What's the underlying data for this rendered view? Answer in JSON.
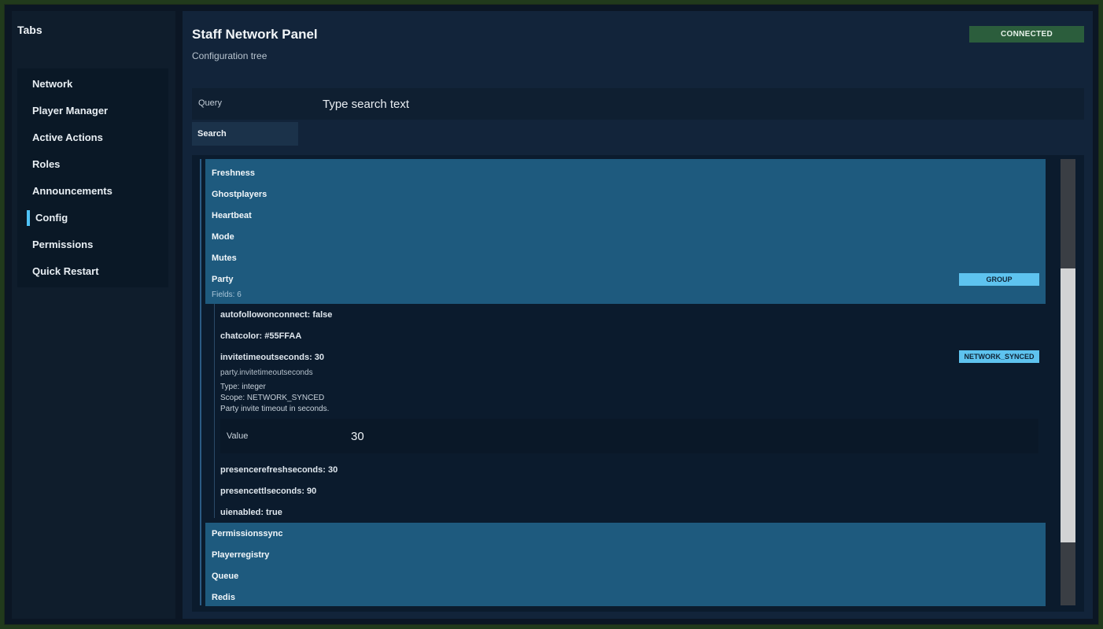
{
  "sidebar": {
    "title": "Tabs",
    "items": [
      {
        "label": "Network"
      },
      {
        "label": "Player Manager"
      },
      {
        "label": "Active Actions"
      },
      {
        "label": "Roles"
      },
      {
        "label": "Announcements"
      },
      {
        "label": "Config",
        "active": true
      },
      {
        "label": "Permissions"
      },
      {
        "label": "Quick Restart"
      }
    ]
  },
  "header": {
    "title": "Staff Network Panel",
    "subtitle": "Configuration tree",
    "status": "CONNECTED"
  },
  "search": {
    "label": "Query",
    "placeholder": "Type search text",
    "button_label": "Search"
  },
  "tree": {
    "groups_before": [
      "Freshness",
      "Ghostplayers",
      "Heartbeat",
      "Mode",
      "Mutes"
    ],
    "expanded_group": {
      "name": "Party",
      "badge": "GROUP",
      "fields_count": "Fields: 6",
      "fields": [
        {
          "label": "autofollowonconnect: false"
        },
        {
          "label": "chatcolor: #55FFAA"
        },
        {
          "label": "invitetimeoutseconds: 30",
          "badge": "NETWORK_SYNCED",
          "path": "party.invitetimeoutseconds",
          "type": "Type: integer",
          "scope": "Scope: NETWORK_SYNCED",
          "description": "Party invite timeout in seconds.",
          "value_label": "Value",
          "value": "30"
        },
        {
          "label": "presencerefreshseconds: 30"
        },
        {
          "label": "presencettlseconds: 90"
        },
        {
          "label": "uienabled: true"
        }
      ]
    },
    "groups_after": [
      "Permissionssync",
      "Playerregistry",
      "Queue",
      "Redis"
    ]
  },
  "colors": {
    "accent": "#4fc3f7",
    "group_bg": "#1e5a7e",
    "status_bg": "#2b5d3c",
    "badge_bg": "#5ec3ef"
  },
  "scroll": {
    "position_fraction": 0.24,
    "visible_fraction": 0.61
  }
}
